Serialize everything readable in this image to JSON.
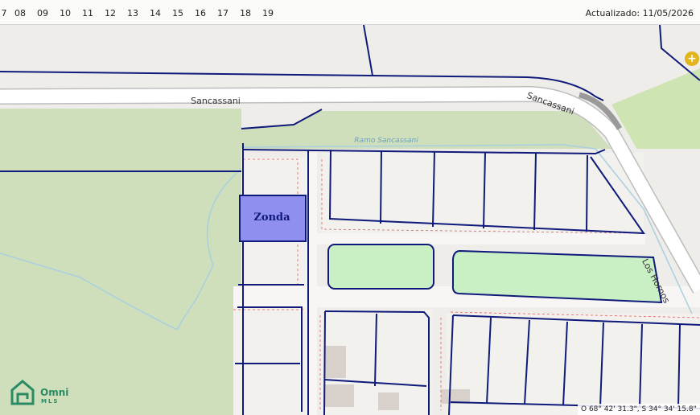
{
  "timeline": {
    "hours": [
      "7",
      "08",
      "09",
      "10",
      "11",
      "12",
      "13",
      "14",
      "15",
      "16",
      "17",
      "18",
      "19"
    ],
    "updated_label": "Actualizado: 11/05/2026"
  },
  "map": {
    "streets": {
      "main": "Sancassani",
      "main_curve": "Sancassani",
      "stream": "Ramo Sancassani",
      "side": "Los Hornos"
    },
    "parcel_label": "Zonda",
    "highlight_color": "#8f8ff0",
    "parcel_border_color": "#0f1a7a"
  },
  "controls": {
    "add_button": "+"
  },
  "brand": {
    "name": "Omni",
    "sub": "MLS"
  },
  "coords_text": "O 68° 42' 31.3\", S 34° 34' 15.8\""
}
